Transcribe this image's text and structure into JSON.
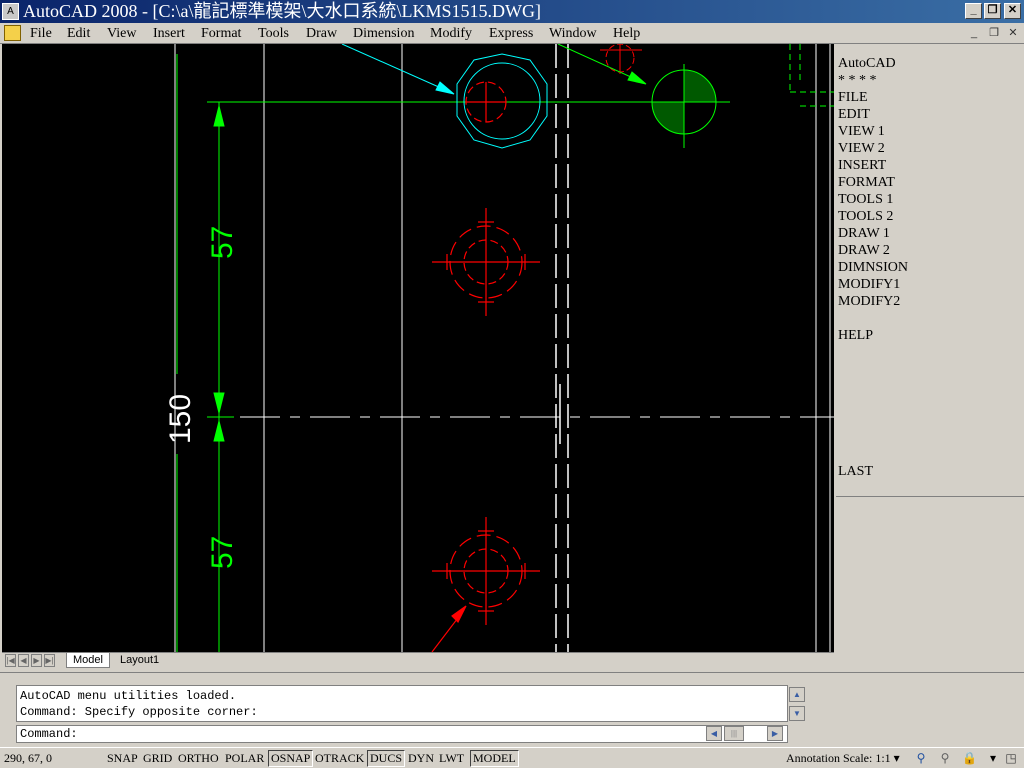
{
  "window": {
    "title": "AutoCAD 2008 - [C:\\a\\龍記標準模架\\大水口系統\\LKMS1515.DWG]",
    "app_icon_text": "A"
  },
  "menubar": {
    "items": [
      "File",
      "Edit",
      "View",
      "Insert",
      "Format",
      "Tools",
      "Draw",
      "Dimension",
      "Modify",
      "Express",
      "Window",
      "Help"
    ]
  },
  "drawing": {
    "dimensions": {
      "top": "57",
      "bottom": "57",
      "total": "150"
    },
    "colors": {
      "background": "#000000",
      "dimension": "#00ff00",
      "holes": "#ff0000",
      "leader": "#00ffff",
      "lines": "#ffffff"
    }
  },
  "screen_menu": {
    "items": [
      "AutoCAD",
      "* * * *",
      "FILE",
      "EDIT",
      "VIEW 1",
      "VIEW 2",
      "INSERT",
      "FORMAT",
      "TOOLS 1",
      "TOOLS 2",
      "DRAW 1",
      "DRAW 2",
      "DIMNSION",
      "MODIFY1",
      "MODIFY2",
      "",
      "HELP"
    ],
    "last": "LAST"
  },
  "layout_tabs": [
    "Model",
    "Layout1"
  ],
  "command": {
    "history": [
      "AutoCAD menu utilities loaded.",
      "Command: Specify opposite corner:"
    ],
    "prompt": "Command:"
  },
  "statusbar": {
    "coords": "290, 67, 0",
    "toggles": [
      {
        "label": "SNAP",
        "on": false
      },
      {
        "label": "GRID",
        "on": false
      },
      {
        "label": "ORTHO",
        "on": false
      },
      {
        "label": "POLAR",
        "on": false
      },
      {
        "label": "OSNAP",
        "on": true
      },
      {
        "label": "OTRACK",
        "on": false
      },
      {
        "label": "DUCS",
        "on": true
      },
      {
        "label": "DYN",
        "on": false
      },
      {
        "label": "LWT",
        "on": false
      },
      {
        "label": "MODEL",
        "on": true
      }
    ],
    "annotation_scale_label": "Annotation Scale:",
    "annotation_scale_value": "1:1"
  }
}
